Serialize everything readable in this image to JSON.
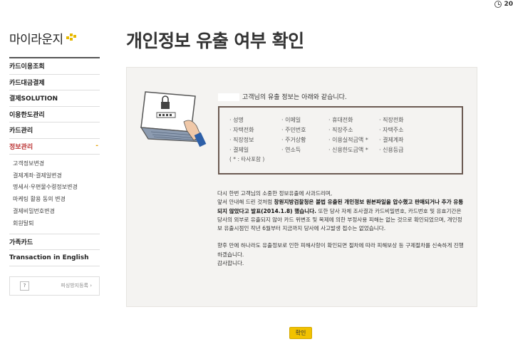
{
  "topbar": {
    "year": "20"
  },
  "sidebar": {
    "logo_text": "마이라운지",
    "items": [
      {
        "label": "카드이용조회"
      },
      {
        "label": "카드대금결제"
      },
      {
        "label": "결제SOLUTION"
      },
      {
        "label": "이용한도관리"
      },
      {
        "label": "카드관리"
      },
      {
        "label": "정보관리",
        "toggle": "-"
      }
    ],
    "subitems": [
      {
        "label": "고객정보변경"
      },
      {
        "label": "결제계좌·결제일변경"
      },
      {
        "label": "명세서·우편물수령정보변경"
      },
      {
        "label": "마케팅 활용 동의 변경"
      },
      {
        "label": "결제비밀번호변경"
      },
      {
        "label": "회원탈퇴"
      }
    ],
    "family": {
      "label": "가족카드"
    },
    "english": {
      "label": "Transaction in English"
    },
    "box": {
      "help": "?",
      "text": "피싱방지등록 ›"
    }
  },
  "page": {
    "title": "개인정보 유출 여부 확인",
    "customer_suffix": "고객님의 유출 정보는 아래와 같습니다.",
    "info_items": [
      "· 성명",
      "· 이메일",
      "· 휴대전화",
      "· 직장전화",
      "· 자택전화",
      "· 주민번호",
      "· 직장주소",
      "· 자택주소",
      "· 직장정보",
      "· 주거상황",
      "· 이용실적금액 *",
      "· 결제계좌",
      "· 결제일",
      "· 연소득",
      "· 신용한도금액 *",
      "· 신용등급"
    ],
    "info_note": "( * : 타사포함 )",
    "p1_line1": "다시 한번 고객님의 소중한 정보유출에 사과드리며,",
    "p1_pre": "앞서 안내해 드린 것처럼 ",
    "p1_bold": "창원지방검찰청은 불법 유출된 개인정보 원본파일을 압수했고 판매되거나 추가 유통되지 않았다고 발표(2014.1.8) 했습니다.",
    "p1_post": " 또한 당사 자체 조사결과 카드비밀번호, 카드번호 및 유효기간은 당사의 외부로 유출되지 않아 카드 위변조 및 복제에 의한 부정사용 피해는 없는 것으로 확인되었으며, 개인정보 유출시점인 작년 6월부터 지금까지 당사에 사고발생 접수는 없었습니다.",
    "p2": "향후 만에 하나라도 유출정보로 인한 피해사항이 확인되면 절차에 따라 피해보상 등 구제절차를 신속하게 진행하겠습니다.",
    "p3": "감사합니다.",
    "confirm_label": "확인"
  }
}
